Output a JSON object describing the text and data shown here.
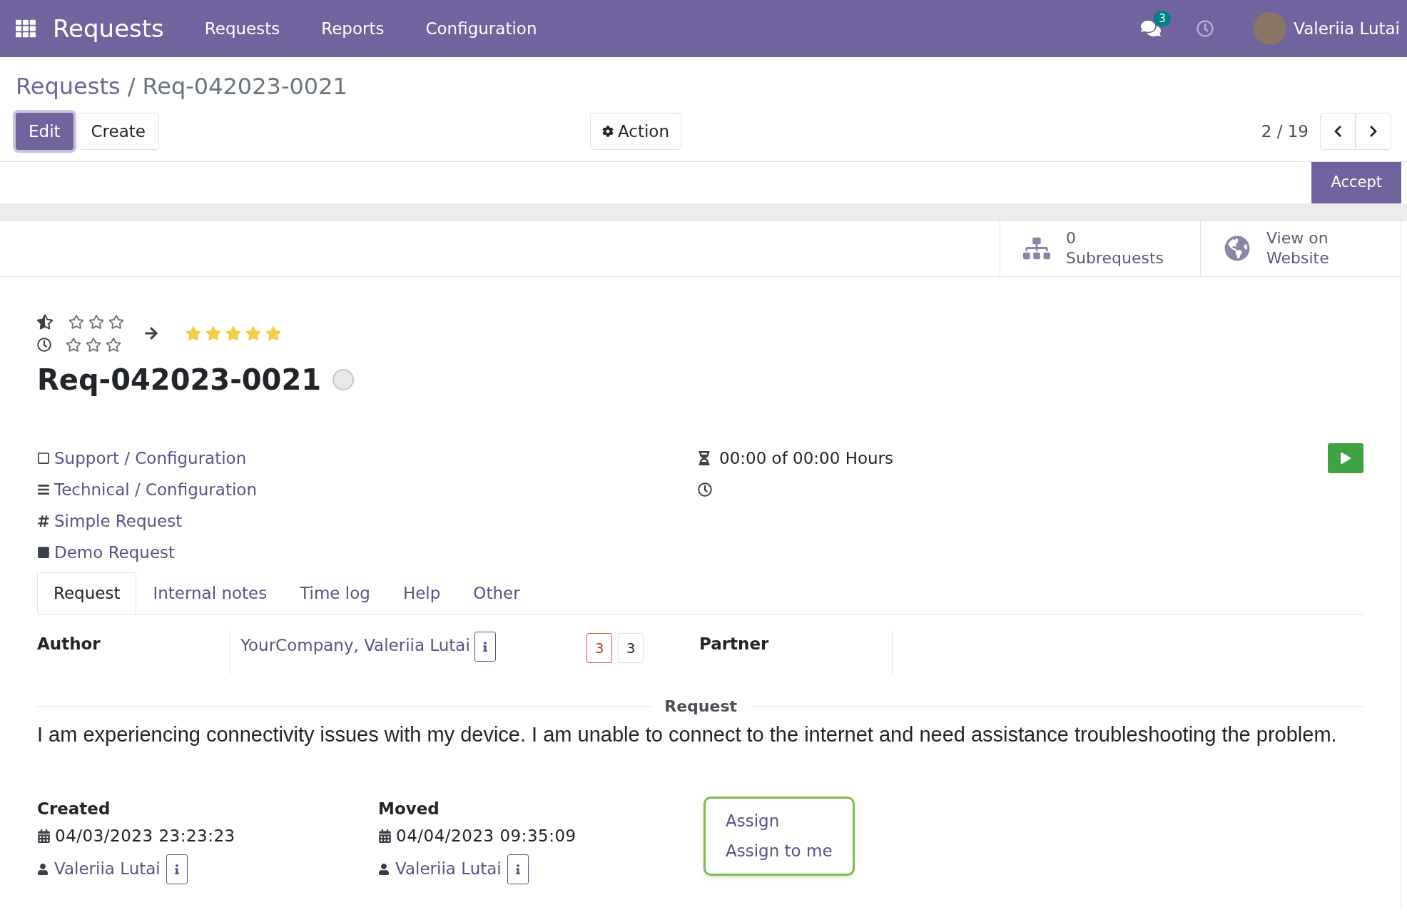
{
  "navbar": {
    "app_title": "Requests",
    "menu": [
      "Requests",
      "Reports",
      "Configuration"
    ],
    "message_count": "3",
    "user": "Valeriia Lutai"
  },
  "breadcrumb": {
    "parent": "Requests",
    "separator": "/",
    "current": "Req-042023-0021"
  },
  "toolbar": {
    "buttons": [
      {
        "label": "Edit",
        "kind": "primary"
      },
      {
        "label": "Create",
        "kind": "secondary"
      }
    ],
    "action": "Action",
    "pager": "2 / 19"
  },
  "status_bar": {
    "buttons": [
      "Accept"
    ]
  },
  "smart_buttons": [
    {
      "kind": "subrequests",
      "value": "0",
      "label": "Subrequests"
    },
    {
      "kind": "website",
      "value": "View on",
      "label": "Website"
    }
  ],
  "ratings": {
    "priority": {
      "stars": 0
    },
    "deadline": {
      "stars": 0
    },
    "rating": {
      "stars": 5
    }
  },
  "title": "Req-042023-0021",
  "fields": [
    {
      "kind": "service",
      "text": "Support / Configuration"
    },
    {
      "kind": "category",
      "text": "Technical / Configuration"
    },
    {
      "kind": "type",
      "text": "Simple Request"
    },
    {
      "kind": "stage",
      "text": "Demo Request"
    }
  ],
  "timer": {
    "text": "00:00 of 00:00 Hours"
  },
  "tabs": [
    {
      "label": "Request",
      "selected": true
    },
    {
      "label": "Internal notes",
      "selected": false
    },
    {
      "label": "Time log",
      "selected": false
    },
    {
      "label": "Help",
      "selected": false
    },
    {
      "label": "Other",
      "selected": false
    }
  ],
  "author": {
    "label": "Author",
    "value": "YourCompany, Valeriia Lutai",
    "counters": [
      {
        "text": "3",
        "kind": "alert"
      },
      {
        "text": "3",
        "kind": "plain"
      }
    ]
  },
  "partner": {
    "label": "Partner"
  },
  "request": {
    "heading": "Request",
    "text": "I am experiencing connectivity issues with my device. I am unable to connect to the internet and need assistance troubleshooting the problem."
  },
  "created": {
    "label": "Created",
    "date": "04/03/2023 23:23:23",
    "user": "Valeriia Lutai"
  },
  "moved": {
    "label": "Moved",
    "date": "04/04/2023 09:35:09",
    "user": "Valeriia Lutai"
  },
  "assign": [
    "Assign",
    "Assign to me"
  ]
}
